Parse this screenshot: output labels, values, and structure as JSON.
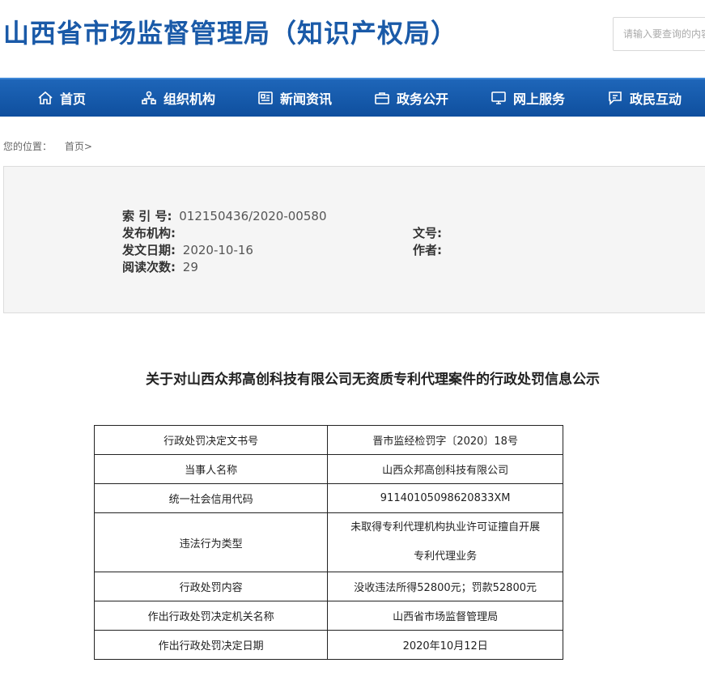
{
  "header": {
    "title": "山西省市场监督管理局（知识产权局）",
    "search_placeholder": "请输入要查询的内容"
  },
  "nav": [
    {
      "label": "首页",
      "icon": "home-icon"
    },
    {
      "label": "组织机构",
      "icon": "org-chart-icon"
    },
    {
      "label": "新闻资讯",
      "icon": "news-icon"
    },
    {
      "label": "政务公开",
      "icon": "briefcase-icon"
    },
    {
      "label": "网上服务",
      "icon": "monitor-icon"
    },
    {
      "label": "政民互动",
      "icon": "chat-icon"
    }
  ],
  "breadcrumb": {
    "prefix": "您的位置：",
    "home": "首页",
    "separator": ">"
  },
  "meta": {
    "index_label": "索 引 号:",
    "index_value": "012150436/2020-00580",
    "publisher_label": "发布机构:",
    "publisher_value": "",
    "doc_no_label": "文号:",
    "doc_no_value": "",
    "date_label": "发文日期:",
    "date_value": "2020-10-16",
    "author_label": "作者:",
    "author_value": "",
    "reads_label": "阅读次数:",
    "reads_value": "29"
  },
  "article": {
    "title": "关于对山西众邦高创科技有限公司无资质专利代理案件的行政处罚信息公示"
  },
  "table": {
    "rows": [
      {
        "label": "行政处罚决定文书号",
        "value": "晋市监经检罚字〔2020〕18号"
      },
      {
        "label": "当事人名称",
        "value": "山西众邦高创科技有限公司"
      },
      {
        "label": "统一社会信用代码",
        "value": "91140105098620833XM"
      },
      {
        "label": "违法行为类型",
        "value_line1": "未取得专利代理机构执业许可证擅自开展",
        "value_line2": "专利代理业务"
      },
      {
        "label": "行政处罚内容",
        "value": "没收违法所得52800元；罚款52800元"
      },
      {
        "label": "作出行政处罚决定机关名称",
        "value": "山西省市场监督管理局"
      },
      {
        "label": "作出行政处罚决定日期",
        "value": "2020年10月12日"
      }
    ]
  },
  "colors": {
    "brand_blue": "#1a5aa8",
    "nav_blue": "#1560b0"
  }
}
